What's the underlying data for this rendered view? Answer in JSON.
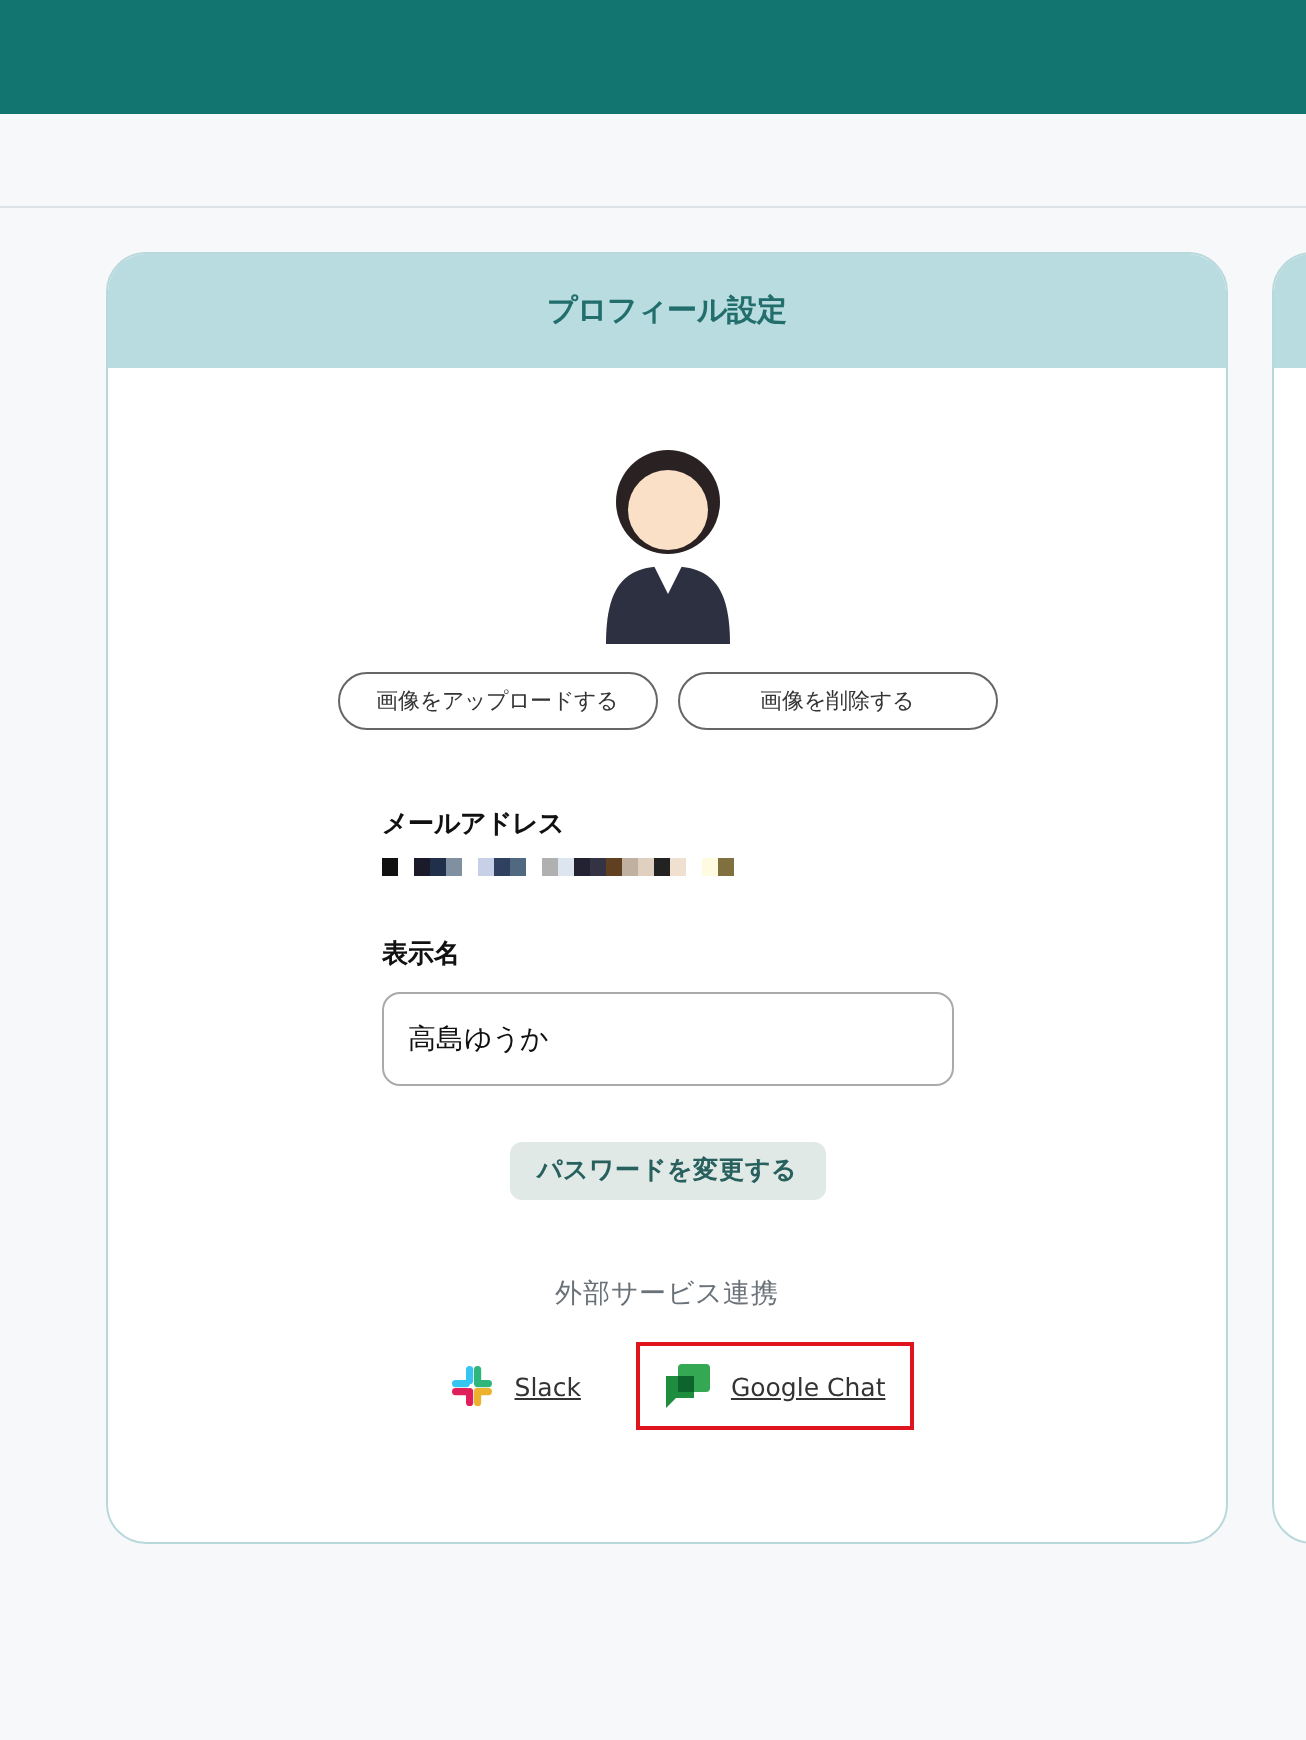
{
  "profile": {
    "title": "プロフィール設定",
    "image_buttons": [
      "画像をアップロードする",
      "画像を削除する"
    ],
    "email_label": "メールアドレス",
    "display_name_label": "表示名",
    "display_name": "高島ゆうか",
    "password_button": "パスワードを変更する",
    "services_heading": "外部サービス連携",
    "services": [
      {
        "kind": "slack",
        "label": "Slack",
        "highlighted": false
      },
      {
        "kind": "google_chat",
        "label": "Google Chat",
        "highlighted": true
      }
    ]
  }
}
